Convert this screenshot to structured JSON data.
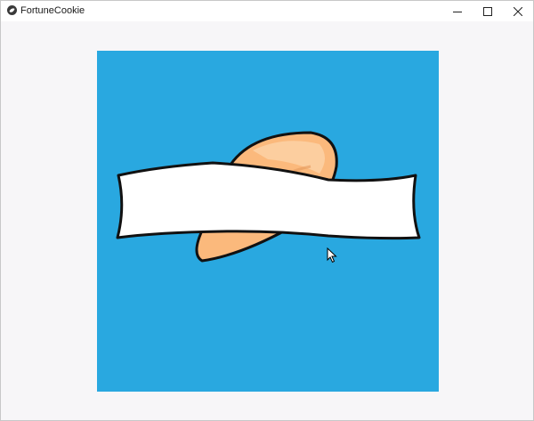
{
  "window": {
    "title": "FortuneCookie",
    "icon": "app-icon",
    "controls": {
      "minimize_icon": "minimize-icon",
      "maximize_icon": "maximize-icon",
      "close_icon": "close-icon"
    }
  },
  "scene": {
    "background_color": "#29a8e0",
    "cookie_color": "#fbb97c",
    "banner_color": "#ffffff",
    "banner_text": ""
  }
}
